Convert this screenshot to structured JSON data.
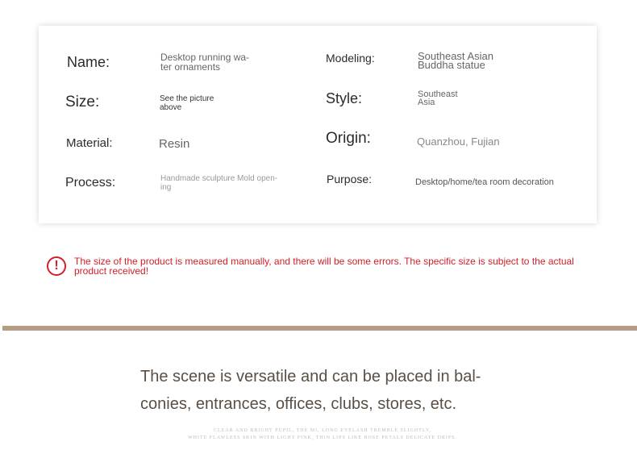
{
  "specs": {
    "name_label": "Name:",
    "name_value": "Desktop running wa- ter ornaments",
    "modeling_label": "Modeling:",
    "modeling_value": "Southeast Asian Buddha statue",
    "size_label": "Size:",
    "size_value": "See the picture above",
    "style_label": "Style:",
    "style_value": "Southeast Asia",
    "material_label": "Material:",
    "material_value": "Resin",
    "origin_label": "Origin:",
    "origin_value": "Quanzhou, Fujian",
    "process_label": "Process:",
    "process_value": "Handmade sculpture Mold open- ing",
    "purpose_label": "Purpose:",
    "purpose_value": "Desktop/home/tea room decoration"
  },
  "notice": {
    "icon": "exclamation-circle-icon",
    "text": "The size of the product is measured manually, and there will be some errors. The specific size is subject to the actual product received!",
    "color": "#d0202a"
  },
  "divider_color": "#b39d84",
  "scene": {
    "text": "The scene is versatile and can be placed in bal- conies, entrances, offices, clubs, stores, etc.",
    "fine_print_1": "CLEAR AND BRIGHT PUPIL, THE MI, LONG EYELASH TREMBLE SLIGHTLY,",
    "fine_print_2": "WHITE FLAWLESS SKIN WITH LIGHT PINK, THIN LIPS LIKE ROSE PETALS DELICATE DRIPS."
  }
}
